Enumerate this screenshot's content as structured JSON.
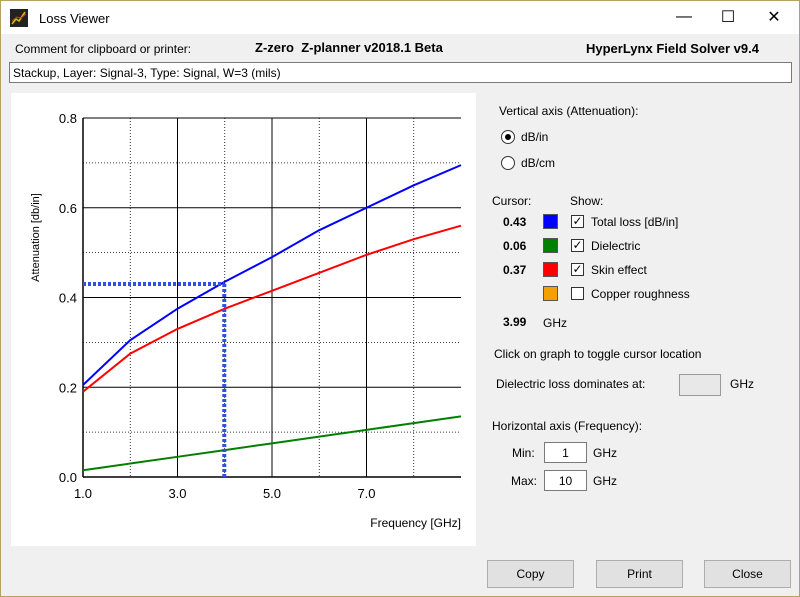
{
  "window": {
    "title": "Loss Viewer",
    "minimize_glyph": "—",
    "maximize_glyph": "☐",
    "close_glyph": "✕"
  },
  "header": {
    "comment_label": "Comment for clipboard or printer:",
    "app_version": "Z-zero  Z-planner v2018.1 Beta",
    "solver": "HyperLynx Field Solver v9.4",
    "comment_value": "Stackup, Layer: Signal-3, Type: Signal, W=3 (mils)"
  },
  "chart_data": {
    "type": "line",
    "xlabel": "Frequency [GHz]",
    "ylabel": "Attenuation [db/in]",
    "xlim": [
      1,
      9.0
    ],
    "ylim": [
      0,
      0.8
    ],
    "x_ticks": [
      1,
      2,
      3,
      4,
      5,
      6,
      7,
      8
    ],
    "x_tick_labels": [
      "1.0",
      "",
      "3.0",
      "",
      "5.0",
      "",
      "7.0",
      ""
    ],
    "y_ticks": [
      0,
      0.1,
      0.2,
      0.3,
      0.4,
      0.5,
      0.6,
      0.7,
      0.8
    ],
    "y_tick_labels": [
      "0.0",
      "",
      "0.2",
      "",
      "0.4",
      "",
      "0.6",
      "",
      "0.8"
    ],
    "grid": true,
    "x": [
      1,
      2,
      3,
      4,
      5,
      6,
      7,
      8,
      9
    ],
    "series": [
      {
        "name": "Total loss [dB/in]",
        "color": "#0000ff",
        "values": [
          0.205,
          0.305,
          0.375,
          0.435,
          0.49,
          0.55,
          0.6,
          0.65,
          0.695
        ]
      },
      {
        "name": "Dielectric",
        "color": "#008000",
        "values": [
          0.015,
          0.03,
          0.045,
          0.06,
          0.075,
          0.09,
          0.105,
          0.12,
          0.135
        ]
      },
      {
        "name": "Skin effect",
        "color": "#ff0000",
        "values": [
          0.19,
          0.275,
          0.33,
          0.375,
          0.415,
          0.455,
          0.495,
          0.53,
          0.56
        ]
      }
    ],
    "cursor": {
      "x": 3.99,
      "y": 0.43
    }
  },
  "panel": {
    "vertical_axis_label": "Vertical axis (Attenuation):",
    "unit_db_in": "dB/in",
    "unit_db_cm": "dB/cm",
    "selected_unit": "dB/in",
    "cursor_label": "Cursor:",
    "show_label": "Show:",
    "legend": [
      {
        "value": "0.43",
        "color": "#0000ff",
        "checked": true,
        "label": "Total loss [dB/in]"
      },
      {
        "value": "0.06",
        "color": "#008000",
        "checked": true,
        "label": "Dielectric"
      },
      {
        "value": "0.37",
        "color": "#ff0000",
        "checked": true,
        "label": "Skin effect"
      },
      {
        "value": "",
        "color": "#f5a000",
        "checked": false,
        "label": "Copper roughness"
      }
    ],
    "cursor_freq": "3.99",
    "cursor_freq_unit": "GHz",
    "click_hint": "Click on graph to toggle cursor location",
    "dielectric_dominates_label": "Dielectric loss dominates at:",
    "dielectric_dominates_value": "",
    "dielectric_unit": "GHz",
    "horizontal_axis_label": "Horizontal axis (Frequency):",
    "min_label": "Min:",
    "min_value": "1",
    "max_label": "Max:",
    "max_value": "10",
    "ghz": "GHz"
  },
  "buttons": {
    "copy": "Copy",
    "print": "Print",
    "close": "Close"
  }
}
